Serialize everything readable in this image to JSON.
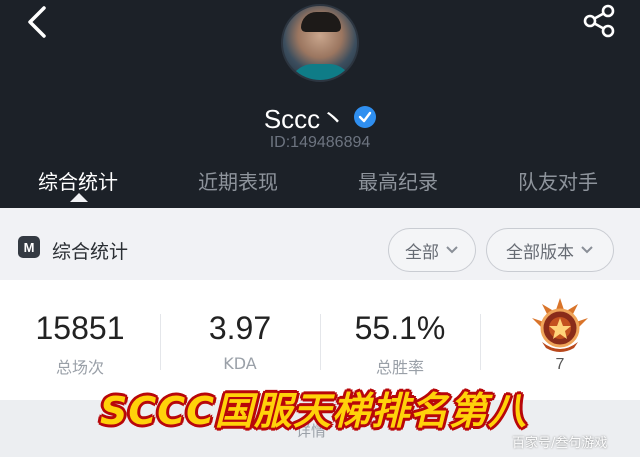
{
  "profile": {
    "name": "Sccc丶",
    "uid": "ID:149486894"
  },
  "tabs": [
    {
      "label": "综合统计"
    },
    {
      "label": "近期表现"
    },
    {
      "label": "最高纪录"
    },
    {
      "label": "队友对手"
    }
  ],
  "section": {
    "title": "综合统计",
    "logo_letter": "M",
    "filter_all": "全部",
    "filter_version": "全部版本"
  },
  "stats": [
    {
      "value": "15851",
      "label": "总场次"
    },
    {
      "value": "3.97",
      "label": "KDA"
    },
    {
      "value": "55.1%",
      "label": "总胜率"
    }
  ],
  "rank": {
    "number": "7"
  },
  "footer": {
    "details_label": "详情"
  },
  "overlay": {
    "headline": "SCCC国服天梯排名第八",
    "watermark": "百家号/叁句游戏"
  },
  "colors": {
    "header_bg": "#1c2128",
    "accent_verified": "#2f8ff0",
    "headline_fill": "#ffd20a",
    "headline_stroke": "#b8070a"
  }
}
